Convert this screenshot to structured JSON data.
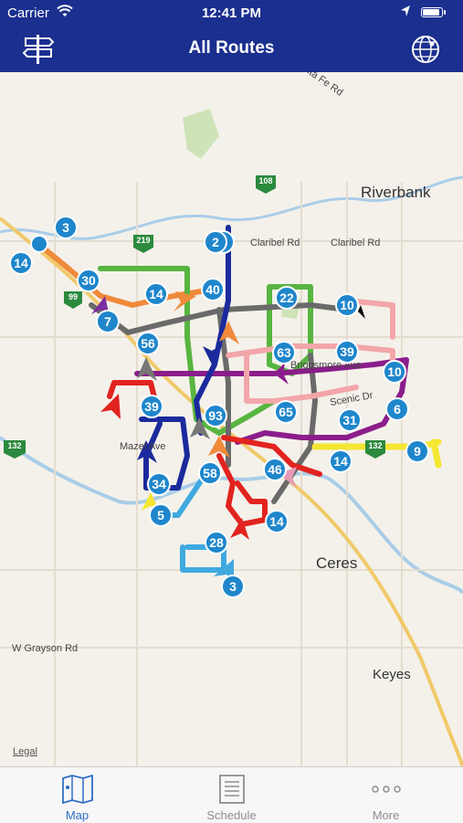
{
  "status_bar": {
    "carrier": "Carrier",
    "time": "12:41 PM"
  },
  "nav": {
    "title": "All Routes",
    "left_icon": "directions-signpost-icon",
    "right_icon": "radar-globe-icon"
  },
  "map": {
    "places": {
      "riverbank": "Riverbank",
      "ceres": "Ceres",
      "keyes": "Keyes",
      "mazel": "Mazel Ave"
    },
    "roads": {
      "claribel_1": "Claribel Rd",
      "claribel_2": "Claribel Rd",
      "grayson": "W Grayson Rd",
      "santa_fe": "Santa Fe Rd",
      "scenic": "Scenic Dr",
      "briggsmore": "Briggsmore Ave"
    },
    "highway_shields": [
      "108",
      "219",
      "99",
      "132",
      "132",
      "108"
    ],
    "route_badges": [
      "3",
      "14",
      "30",
      "7",
      "14",
      "40",
      "2",
      "22",
      "10",
      "56",
      "63",
      "39",
      "10",
      "39",
      "93",
      "65",
      "31",
      "6",
      "9",
      "14",
      "58",
      "34",
      "46",
      "5",
      "14",
      "28",
      "3",
      "2"
    ],
    "legal": "Legal"
  },
  "tabs": [
    {
      "label": "Map",
      "icon": "map-icon",
      "active": true
    },
    {
      "label": "Schedule",
      "icon": "schedule-icon",
      "active": false
    },
    {
      "label": "More",
      "icon": "more-dots-icon",
      "active": false
    }
  ],
  "colors": {
    "navbar": "#1b2f8f",
    "badge": "#1f86cc",
    "tab_active": "#2f6dc7"
  }
}
